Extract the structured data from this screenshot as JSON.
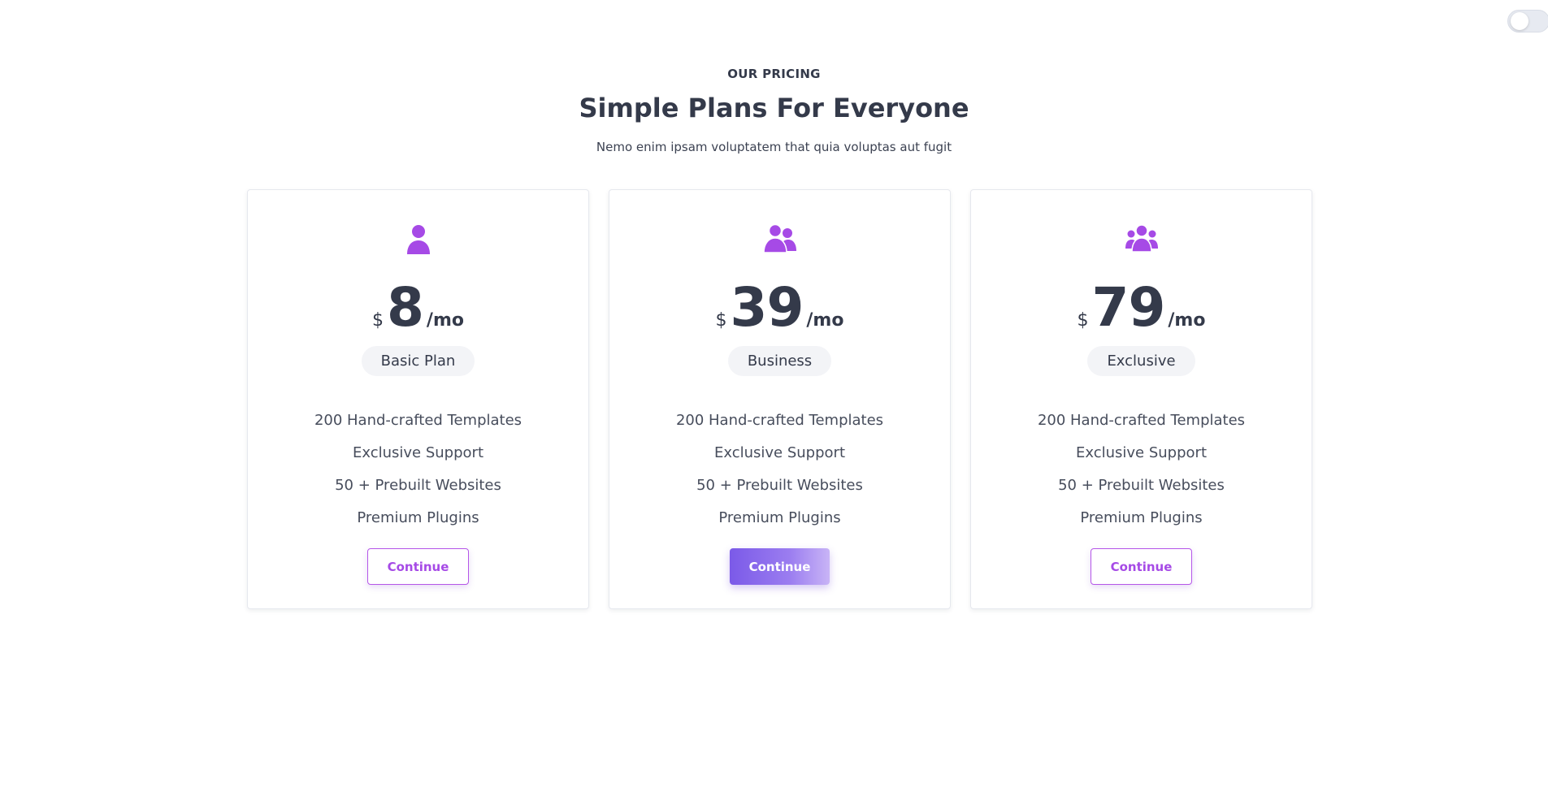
{
  "header": {
    "eyebrow": "OUR PRICING",
    "title": "Simple Plans For Everyone",
    "subtitle": "Nemo enim ipsam voluptatem that quia voluptas aut fugit"
  },
  "colors": {
    "accent": "#a64ae6",
    "icon": "#a64ae6",
    "heading": "#343a4a"
  },
  "plans": [
    {
      "icon": "user-icon",
      "currency": "$",
      "price": "8",
      "period": "/mo",
      "name": "Basic Plan",
      "features": [
        "200 Hand-crafted Templates",
        "Exclusive Support",
        "50 + Prebuilt Websites",
        "Premium Plugins"
      ],
      "button": "Continue",
      "highlighted": false
    },
    {
      "icon": "user-pair-icon",
      "currency": "$",
      "price": "39",
      "period": "/mo",
      "name": "Business",
      "features": [
        "200 Hand-crafted Templates",
        "Exclusive Support",
        "50 + Prebuilt Websites",
        "Premium Plugins"
      ],
      "button": "Continue",
      "highlighted": true
    },
    {
      "icon": "user-group-icon",
      "currency": "$",
      "price": "79",
      "period": "/mo",
      "name": "Exclusive",
      "features": [
        "200 Hand-crafted Templates",
        "Exclusive Support",
        "50 + Prebuilt Websites",
        "Premium Plugins"
      ],
      "button": "Continue",
      "highlighted": false
    }
  ]
}
